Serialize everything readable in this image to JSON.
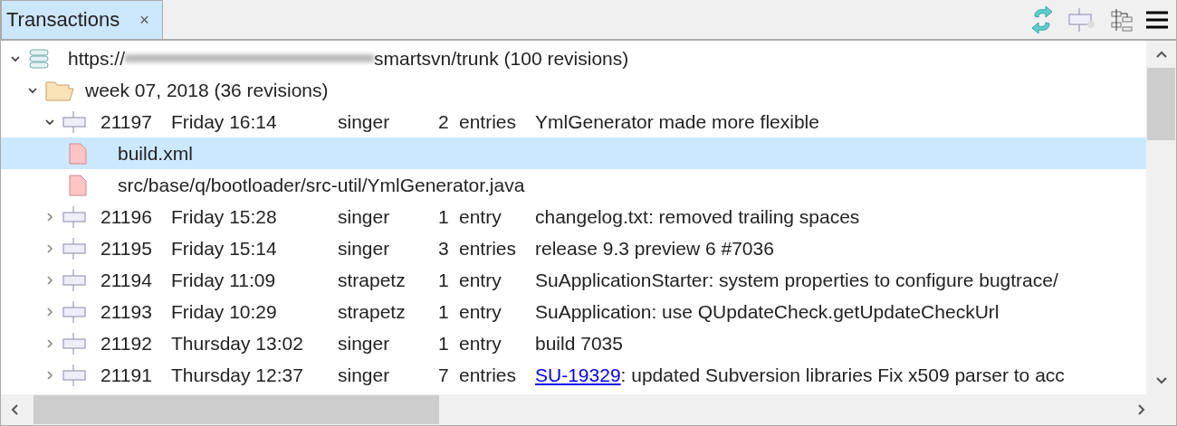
{
  "tab": {
    "label": "Transactions",
    "close": "×",
    "selected": true
  },
  "tree": [
    {
      "kind": "repository",
      "expanded": true,
      "prefix": "https://",
      "suffix": "smartsvn/trunk (100 revisions)",
      "children": [
        {
          "kind": "week",
          "expanded": true,
          "label": "week 07, 2018 (36 revisions)",
          "children": [
            {
              "kind": "revision",
              "expanded": true,
              "revision": "21197",
              "date": "Friday 16:14",
              "author": "singer",
              "count": "2",
              "unit": "entries",
              "message": "YmlGenerator made more flexible",
              "children": [
                {
                  "kind": "file",
                  "selected": true,
                  "path": "build.xml"
                },
                {
                  "kind": "file",
                  "selected": false,
                  "path": "src/base/q/bootloader/src-util/YmlGenerator.java"
                }
              ]
            },
            {
              "kind": "revision",
              "expanded": false,
              "revision": "21196",
              "date": "Friday 15:28",
              "author": "singer",
              "count": "1",
              "unit": "entry",
              "message": "changelog.txt: removed trailing spaces"
            },
            {
              "kind": "revision",
              "expanded": false,
              "revision": "21195",
              "date": "Friday 15:14",
              "author": "singer",
              "count": "3",
              "unit": "entries",
              "message": "release 9.3 preview 6 #7036"
            },
            {
              "kind": "revision",
              "expanded": false,
              "revision": "21194",
              "date": "Friday 11:09",
              "author": "strapetz",
              "count": "1",
              "unit": "entry",
              "message": "SuApplicationStarter: system properties to configure bugtrace/"
            },
            {
              "kind": "revision",
              "expanded": false,
              "revision": "21193",
              "date": "Friday 10:29",
              "author": "strapetz",
              "count": "1",
              "unit": "entry",
              "message": "SuApplication: use QUpdateCheck.getUpdateCheckUrl"
            },
            {
              "kind": "revision",
              "expanded": false,
              "revision": "21192",
              "date": "Thursday 13:02",
              "author": "singer",
              "count": "1",
              "unit": "entry",
              "message": "build 7035"
            },
            {
              "kind": "revision",
              "expanded": false,
              "revision": "21191",
              "date": "Thursday 12:37",
              "author": "singer",
              "count": "7",
              "unit": "entries",
              "link": "SU-19329",
              "message": ": updated Subversion libraries  Fix x509 parser to acc"
            }
          ]
        }
      ]
    }
  ]
}
